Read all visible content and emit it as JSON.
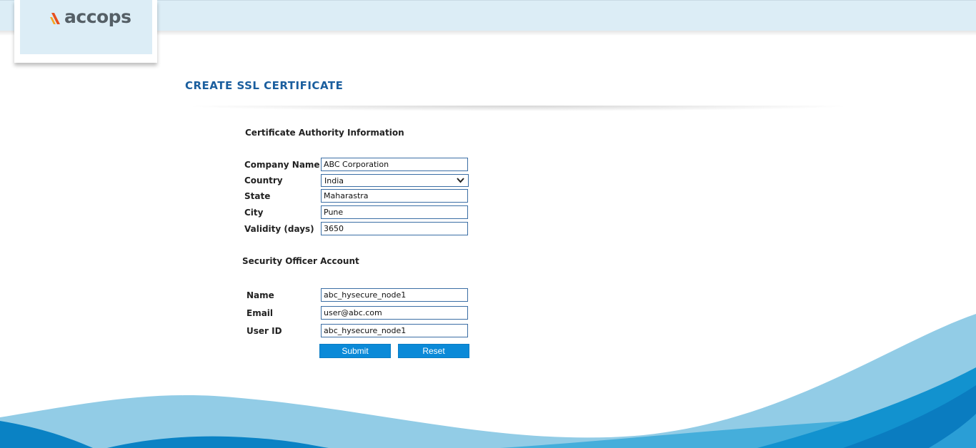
{
  "brand": {
    "logo_text": "accops"
  },
  "page": {
    "title": "CREATE SSL CERTIFICATE"
  },
  "ca_section": {
    "heading": "Certificate Authority Information",
    "company_label": "Company Name",
    "company_value": "ABC Corporation",
    "country_label": "Country",
    "country_selected": "India",
    "state_label": "State",
    "state_value": "Maharastra",
    "city_label": "City",
    "city_value": "Pune",
    "validity_label": "Validity (days)",
    "validity_value": "3650"
  },
  "so_section": {
    "heading": "Security Officer Account",
    "name_label": "Name",
    "name_value": "abc_hysecure_node1",
    "email_label": "Email",
    "email_value": "user@abc.com",
    "userid_label": "User ID",
    "userid_value": "abc_hysecure_node1"
  },
  "buttons": {
    "submit": "Submit",
    "reset": "Reset"
  },
  "colors": {
    "title": "#1a5e9e",
    "header_bg": "#dcedf6",
    "button": "#0b8ad8",
    "wave_light": "#92cce6",
    "wave_dark": "#0a82c4"
  },
  "icons": {
    "logo_mark": "accops-logo-mark",
    "select_arrow": "chevron-down-icon"
  }
}
